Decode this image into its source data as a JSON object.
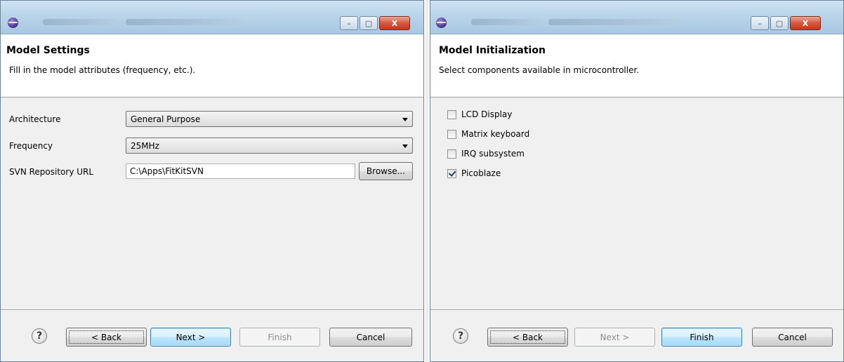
{
  "left_dialog": {
    "header": {
      "title": "Model Settings",
      "description": "Fill in the model attributes (frequency, etc.)."
    },
    "fields": {
      "architecture_label": "Architecture",
      "architecture_value": "General Purpose",
      "frequency_label": "Frequency",
      "frequency_value": "25MHz",
      "svn_label": "SVN Repository URL",
      "svn_value": "C:\\Apps\\FitKitSVN",
      "browse_label": "Browse..."
    },
    "buttons": {
      "help": "?",
      "back": "< Back",
      "next": "Next >",
      "finish": "Finish",
      "cancel": "Cancel"
    }
  },
  "right_dialog": {
    "header": {
      "title": "Model Initialization",
      "description": "Select components available in microcontroller."
    },
    "components": [
      {
        "label": "LCD Display",
        "checked": false
      },
      {
        "label": "Matrix keyboard",
        "checked": false
      },
      {
        "label": "IRQ subsystem",
        "checked": false
      },
      {
        "label": "Picoblaze",
        "checked": true
      }
    ],
    "buttons": {
      "help": "?",
      "back": "< Back",
      "next": "Next >",
      "finish": "Finish",
      "cancel": "Cancel"
    }
  },
  "window_controls": {
    "minimize": "–",
    "maximize": "▢",
    "close": "X"
  }
}
